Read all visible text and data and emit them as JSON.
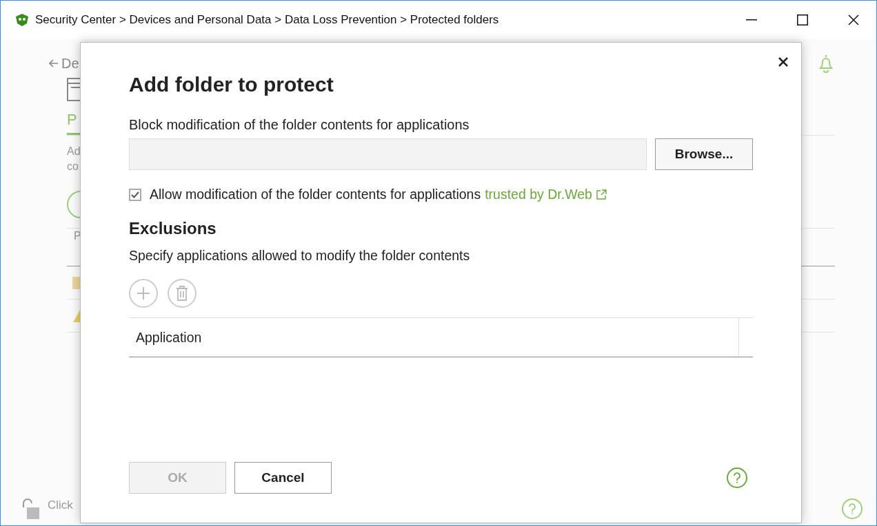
{
  "window": {
    "title": "Security Center > Devices and Personal Data > Data Loss Prevention > Protected folders"
  },
  "background": {
    "back_link": "De",
    "tabs": [
      {
        "label": "P",
        "selected": true
      }
    ],
    "description": [
      "Ad",
      "co"
    ],
    "table_header": "P",
    "footer": "Click"
  },
  "dialog": {
    "title": "Add folder to protect",
    "field_label": "Block modification of the folder contents for applications",
    "browse_button": "Browse...",
    "checkbox": {
      "label": "Allow modification of the folder contents for applications",
      "link": "trusted by Dr.Web",
      "checked": true
    },
    "exclusions_title": "Exclusions",
    "exclusions_hint": "Specify applications allowed to modify the folder contents",
    "tools": [
      {
        "kind": "add",
        "disabled": true
      },
      {
        "kind": "delete",
        "disabled": true
      }
    ],
    "table": {
      "columns": [
        "Application"
      ]
    },
    "buttons": [
      {
        "label": "OK",
        "disabled": true
      },
      {
        "label": "Cancel",
        "disabled": false
      }
    ]
  }
}
